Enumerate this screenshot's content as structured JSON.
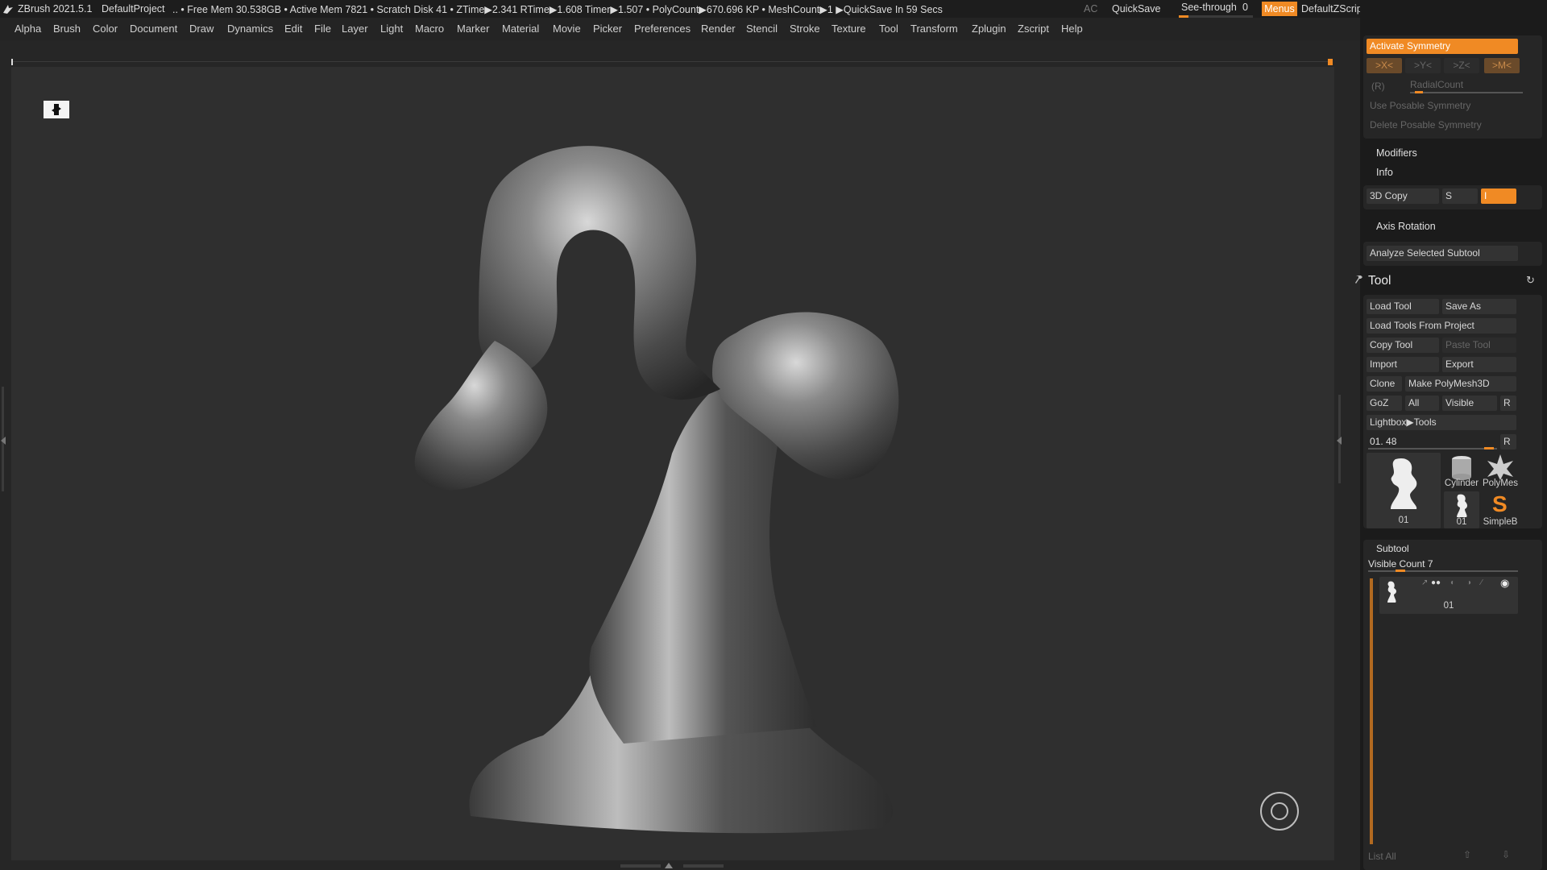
{
  "titlebar": {
    "app": "ZBrush 2021.5.1",
    "project": "DefaultProject",
    "stats": ".. • Free Mem 30.538GB • Active Mem 7821 • Scratch Disk 41 •  ZTime▶2.341 RTime▶1.608 Timer▶1.507 • PolyCount▶670.696 KP  • MeshCount▶1  ▶QuickSave In 59 Secs",
    "ac": "AC",
    "quicksave": "QuickSave",
    "see_through": "See-through",
    "see_through_value": "0",
    "see_through_level": 0.0,
    "menus": "Menus",
    "defaultzscript": "DefaultZScript"
  },
  "menubar": [
    "Alpha",
    "Brush",
    "Color",
    "Document",
    "Draw",
    "Dynamics",
    "Edit",
    "File",
    "Layer",
    "Light",
    "Macro",
    "Marker",
    "Material",
    "Movie",
    "Picker",
    "Preferences",
    "Render",
    "Stencil",
    "Stroke",
    "Texture",
    "Tool",
    "Transform",
    "Zplugin",
    "Zscript",
    "Help"
  ],
  "symmetry": {
    "activate": "Activate Symmetry",
    "axes": [
      ">X<",
      ">Y<",
      ">Z<",
      ">M<"
    ],
    "r": "(R)",
    "radial": "RadialCount",
    "use_posable": "Use Posable Symmetry",
    "delete_posable": "Delete Posable Symmetry"
  },
  "sections": {
    "modifiers": "Modifiers",
    "info": "Info",
    "copy3d": "3D Copy",
    "s": "S",
    "i": "I",
    "axis_rotation": "Axis Rotation",
    "analyze": "Analyze Selected Subtool"
  },
  "tool": {
    "title": "Tool",
    "load_tool": "Load Tool",
    "save_as": "Save As",
    "load_from_project": "Load Tools From Project",
    "copy_tool": "Copy Tool",
    "paste_tool": "Paste Tool",
    "import": "Import",
    "export": "Export",
    "clone": "Clone",
    "make_polymesh": "Make PolyMesh3D",
    "goz": "GoZ",
    "all": "All",
    "visible": "Visible",
    "r": "R",
    "lightbox": "Lightbox▶Tools",
    "current": "01. 48",
    "thumbs": {
      "main": "01",
      "cylinder": "Cylinder",
      "polymesh": "PolyMes",
      "small": "01",
      "simpleb": "SimpleB"
    }
  },
  "subtool": {
    "title": "Subtool",
    "visible_count": "Visible Count 7",
    "item": "01",
    "list_all": "List All"
  },
  "colors": {
    "accent": "#f08a24",
    "bg": "#262626",
    "panel": "#1b1b1b"
  }
}
